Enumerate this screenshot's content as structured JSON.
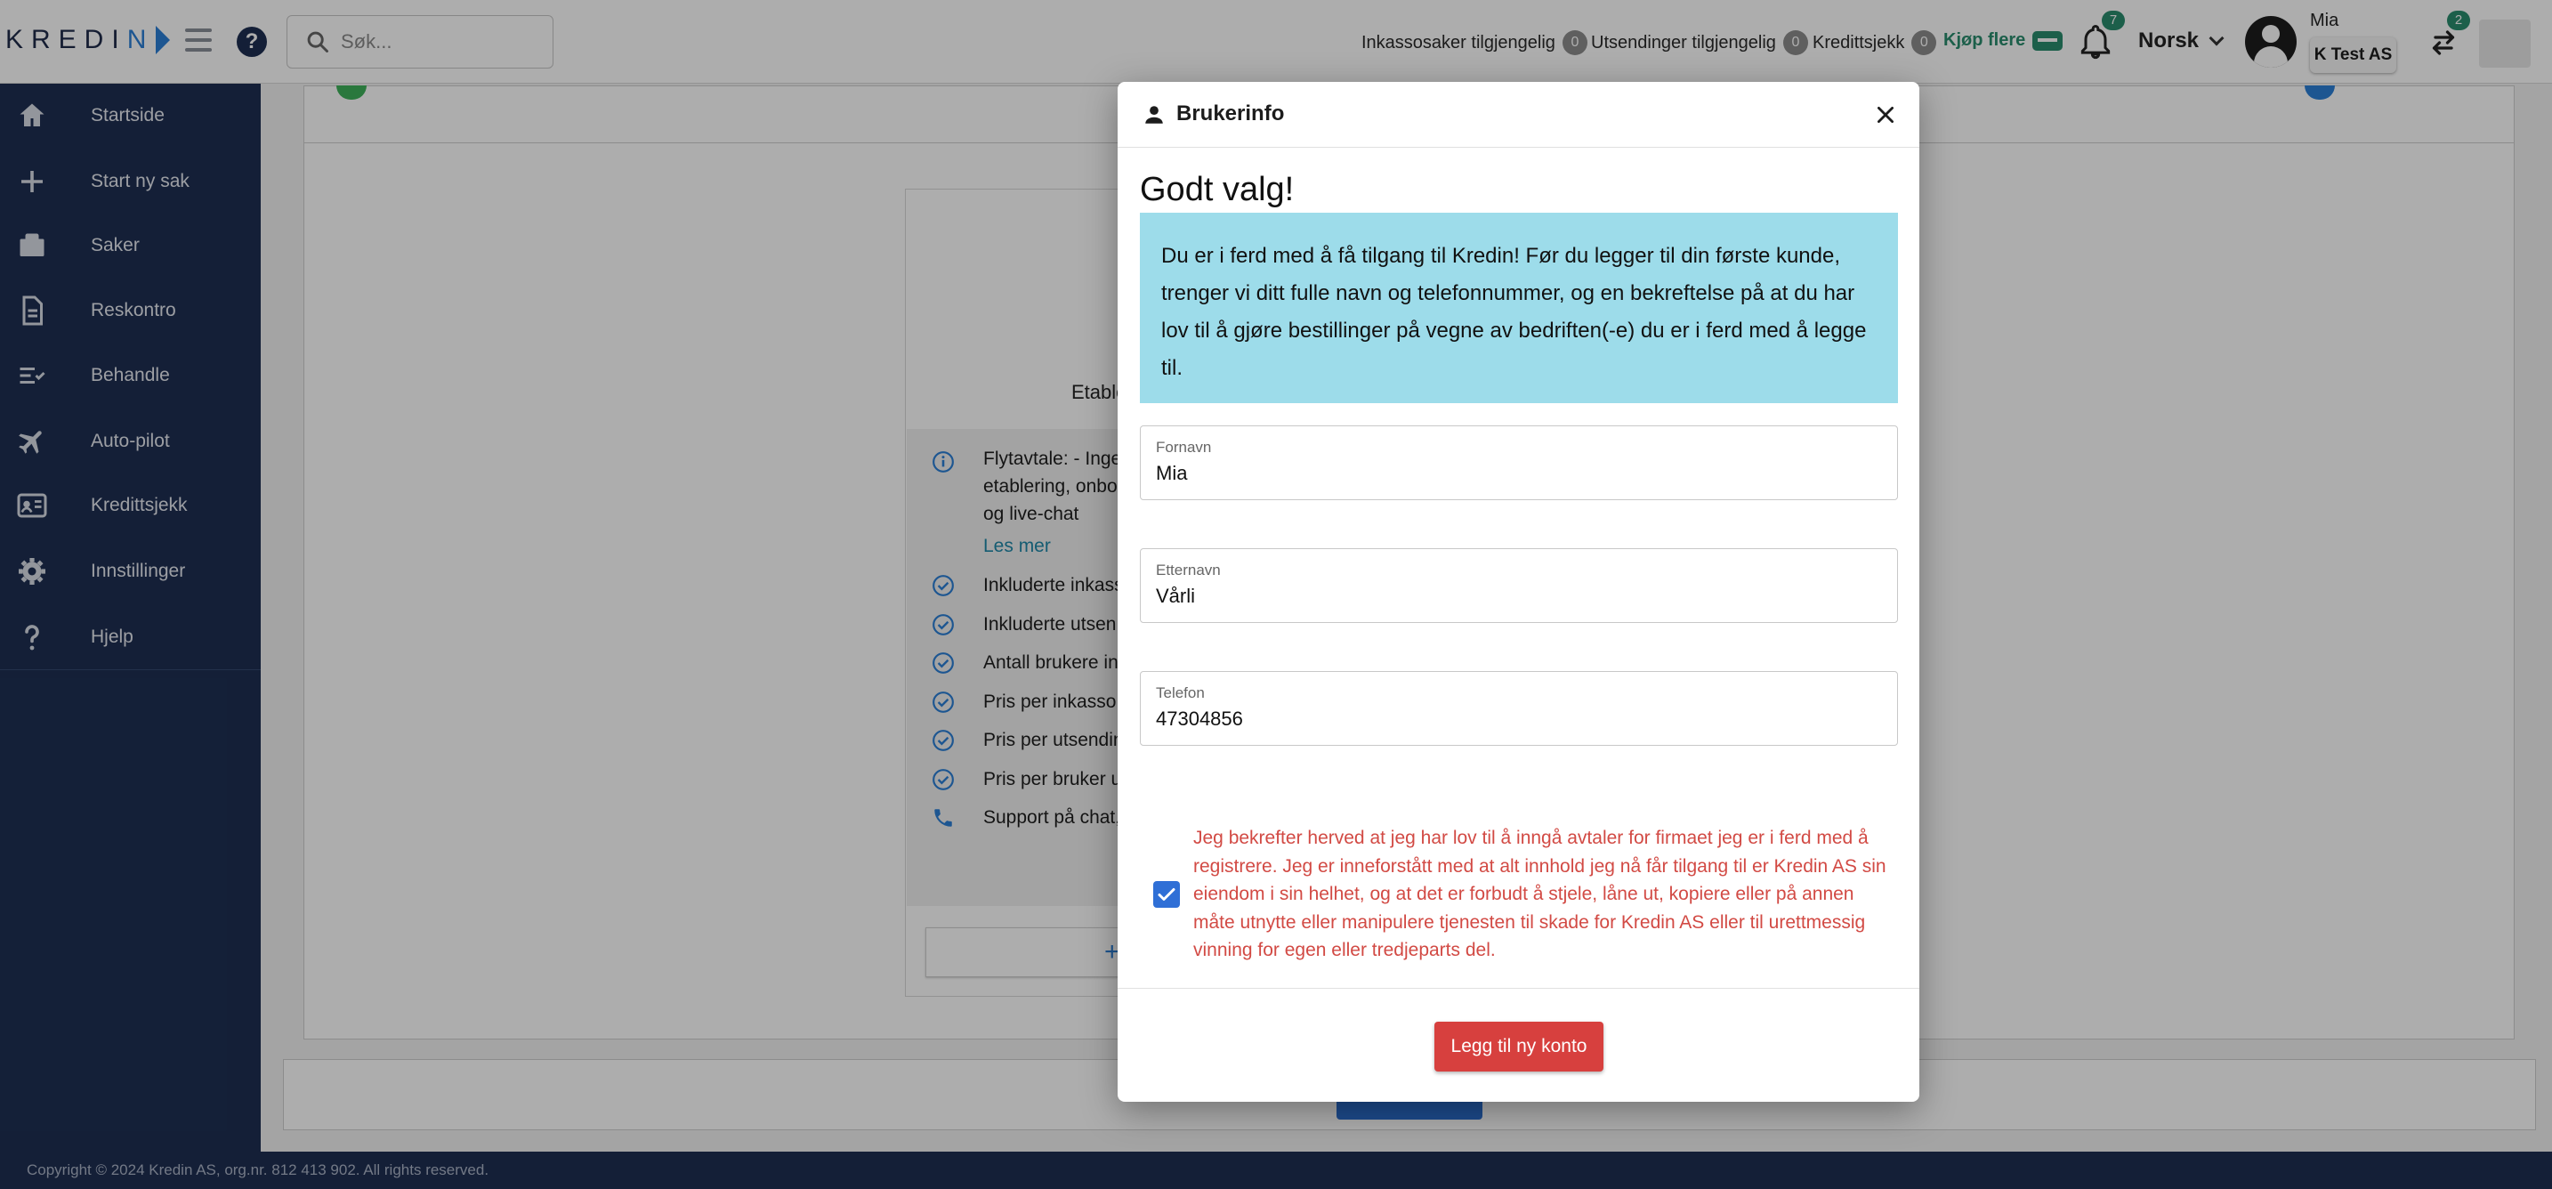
{
  "app": {
    "logo_text": "KREDIN",
    "search_placeholder": "Søk..."
  },
  "header": {
    "status": [
      {
        "label": "Inkassosaker tilgjengelig",
        "count": "0"
      },
      {
        "label": "Utsendinger tilgjengelig",
        "count": "0"
      },
      {
        "label": "Kredittsjekk",
        "count": "0"
      }
    ],
    "buy_more_label": "Kjøp flere",
    "notifications_count": "7",
    "language": "Norsk",
    "user_name": "Mia",
    "company": "K Test AS",
    "switch_count": "2"
  },
  "sidebar": {
    "items": [
      {
        "label": "Startside",
        "icon": "home-icon"
      },
      {
        "label": "Start ny sak",
        "icon": "plus-icon"
      },
      {
        "label": "Saker",
        "icon": "briefcase-icon"
      },
      {
        "label": "Reskontro",
        "icon": "document-icon"
      },
      {
        "label": "Behandle",
        "icon": "checklist-icon"
      },
      {
        "label": "Auto-pilot",
        "icon": "airplane-icon"
      },
      {
        "label": "Kredittsjekk",
        "icon": "id-card-icon"
      },
      {
        "label": "Innstillinger",
        "icon": "gear-icon"
      },
      {
        "label": "Hjelp",
        "icon": "question-icon"
      }
    ]
  },
  "plan": {
    "title": "Etable",
    "features": [
      {
        "text": "Flytavtale: - Inge",
        "icon": "info-icon"
      },
      {
        "text": "etablering, onbo",
        "icon": ""
      },
      {
        "text": "og live-chat",
        "icon": ""
      },
      {
        "text": "Inkluderte inkass",
        "icon": "check-circle-icon"
      },
      {
        "text": "Inkluderte utsen",
        "icon": "check-circle-icon"
      },
      {
        "text": "Antall brukere in",
        "icon": "check-circle-icon"
      },
      {
        "text": "Pris per inkasso",
        "icon": "check-circle-icon"
      },
      {
        "text": "Pris per utsendin",
        "icon": "check-circle-icon"
      },
      {
        "text": "Pris per bruker u",
        "icon": "check-circle-icon"
      },
      {
        "text": "Support på chat,",
        "icon": "phone-icon"
      }
    ],
    "read_more": "Les mer",
    "add_symbol": "+"
  },
  "modal": {
    "title": "Brukerinfo",
    "heading": "Godt valg!",
    "info": "Du er i ferd med å få tilgang til Kredin! Før du legger til din første kunde, trenger vi ditt fulle navn og telefonnummer, og en bekreftelse på at du har lov til å gjøre bestillinger på vegne av bedriften(-e) du er i ferd med å legge til.",
    "fields": {
      "first_name": {
        "label": "Fornavn",
        "value": "Mia"
      },
      "last_name": {
        "label": "Etternavn",
        "value": "Vårli"
      },
      "phone": {
        "label": "Telefon",
        "value": "47304856"
      }
    },
    "consent_checked": true,
    "consent_text": "Jeg bekrefter herved at jeg har lov til å inngå avtaler for firmaet jeg er i ferd med å registrere. Jeg er inneforstått med at alt innhold jeg nå får tilgang til er Kredin AS sin eiendom i sin helhet, og at det er forbudt å stjele, låne ut, kopiere eller på annen måte utnytte eller manipulere tjenesten til skade for Kredin AS eller til urettmessig vinning for egen eller tredjeparts del.",
    "submit_label": "Legg til ny konto"
  },
  "footer": {
    "copyright": "Copyright © 2024 Kredin AS, org.nr. 812 413 902. All rights reserved."
  },
  "colors": {
    "sidebar": "#1e2f52",
    "accent_green": "#2a8c6e",
    "info_box": "#9ddcea",
    "consent_text": "#d24a44",
    "primary_button": "#d7403e",
    "checkbox": "#2f6fd6"
  }
}
